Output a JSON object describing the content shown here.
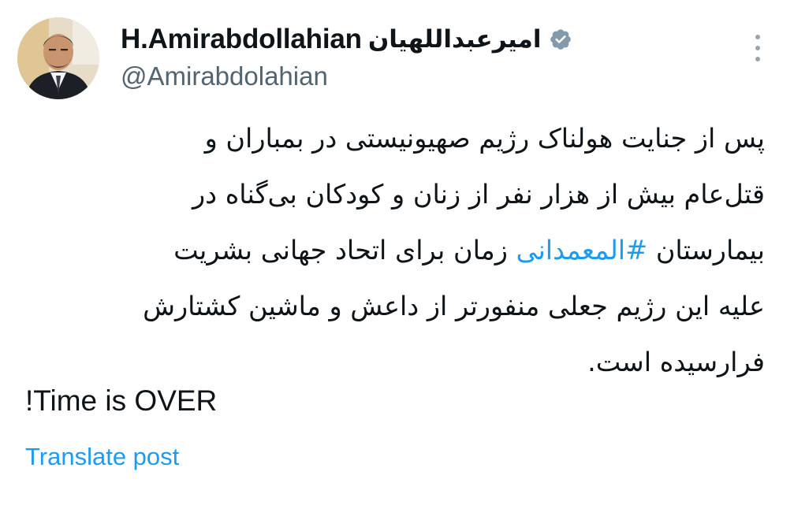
{
  "author": {
    "name_latin": "H.Amirabdollahian",
    "name_persian": "امیرعبداللهیان",
    "handle": "@Amirabdolahian",
    "verified_icon": "verified-badge-icon",
    "avatar_icon": "profile-photo"
  },
  "post": {
    "lines": [
      {
        "before": "پس از جنایت هولناک رژیم صهیونیستی در بمباران و",
        "hashtag": "",
        "after": ""
      },
      {
        "before": "قتل‌عام بیش از هزار نفر از زنان و کودکان بی‌گناه در",
        "hashtag": "",
        "after": ""
      },
      {
        "before": "بیمارستان ",
        "hashtag": "#المعمدانی",
        "after": " زمان برای اتحاد جهانی بشریت"
      },
      {
        "before": "علیه این رژیم جعلی منفورتر از داعش و ماشین کشتارش",
        "hashtag": "",
        "after": ""
      },
      {
        "before": "فرارسیده است.",
        "hashtag": "",
        "after": ""
      }
    ],
    "closing": "Time is OVER!"
  },
  "actions": {
    "translate_label": "Translate post",
    "more_icon": "more-options-icon"
  },
  "colors": {
    "link": "#1d9bf0",
    "handle": "#536471",
    "verified": "#829aab",
    "text": "#0f1419"
  }
}
